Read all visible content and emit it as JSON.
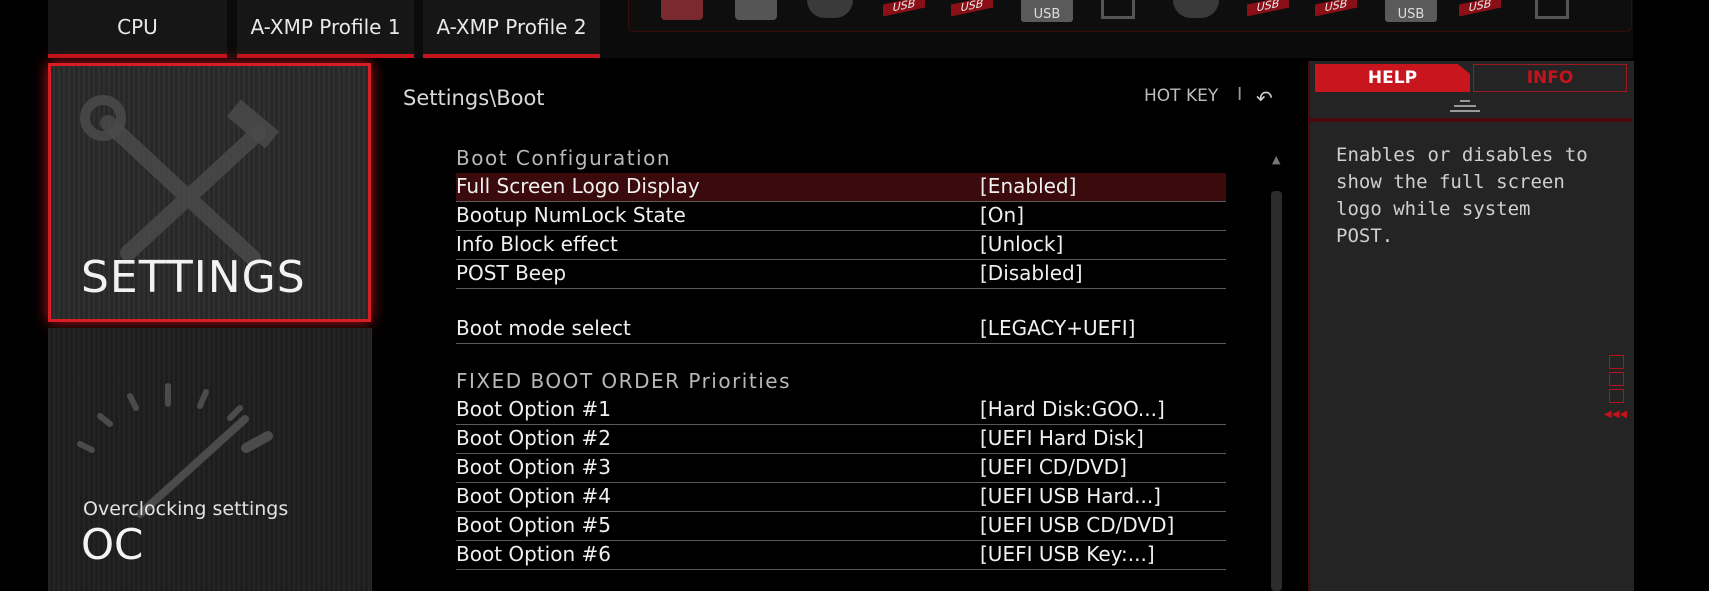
{
  "top_tabs": [
    "CPU",
    "A-XMP Profile 1",
    "A-XMP Profile 2"
  ],
  "devices": [
    {
      "icon": "hdd-icon"
    },
    {
      "icon": "hdd-icon"
    },
    {
      "icon": "disc-icon"
    },
    {
      "icon": "usb-icon",
      "label": "USB"
    },
    {
      "icon": "usb-icon",
      "label": "USB"
    },
    {
      "icon": "usb-stick-icon",
      "label": "USB"
    },
    {
      "icon": "drive-icon"
    },
    {
      "icon": "disc-icon"
    },
    {
      "icon": "usb-icon",
      "label": "USB"
    },
    {
      "icon": "usb-icon",
      "label": "USB"
    },
    {
      "icon": "usb-stick-icon",
      "label": "USB"
    },
    {
      "icon": "usb-icon",
      "label": "USB"
    },
    {
      "icon": "drive-icon"
    }
  ],
  "sidebar": {
    "settings": {
      "title": "SETTINGS"
    },
    "oc": {
      "subtitle": "Overclocking settings",
      "title": "OC"
    }
  },
  "header": {
    "breadcrumb": "Settings\\Boot",
    "hotkey": "HOT KEY",
    "separator": "I",
    "back_icon": "back-arrow-icon"
  },
  "boot": {
    "section_config": "Boot Configuration",
    "config_rows": [
      {
        "label": "Full Screen Logo Display",
        "value": "[Enabled]"
      },
      {
        "label": "Bootup NumLock State",
        "value": "[On]"
      },
      {
        "label": "Info Block effect",
        "value": "[Unlock]"
      },
      {
        "label": "POST Beep",
        "value": "[Disabled]"
      }
    ],
    "mode_row": {
      "label": "Boot mode select",
      "value": "[LEGACY+UEFI]"
    },
    "section_fixed": "FIXED BOOT ORDER Priorities",
    "options": [
      {
        "label": "Boot Option #1",
        "value": "[Hard Disk:GOO...]"
      },
      {
        "label": "Boot Option #2",
        "value": "[UEFI Hard Disk]"
      },
      {
        "label": "Boot Option #3",
        "value": "[UEFI CD/DVD]"
      },
      {
        "label": "Boot Option #4",
        "value": "[UEFI USB Hard...]"
      },
      {
        "label": "Boot Option #5",
        "value": "[UEFI USB CD/DVD]"
      },
      {
        "label": "Boot Option #6",
        "value": "[UEFI USB Key:...]"
      }
    ]
  },
  "help": {
    "tab_help": "HELP",
    "tab_info": "INFO",
    "text": "Enables or disables to show the full screen logo while system POST."
  },
  "colors": {
    "accent": "#c3141c",
    "selected_row": "#3a0a0d"
  }
}
